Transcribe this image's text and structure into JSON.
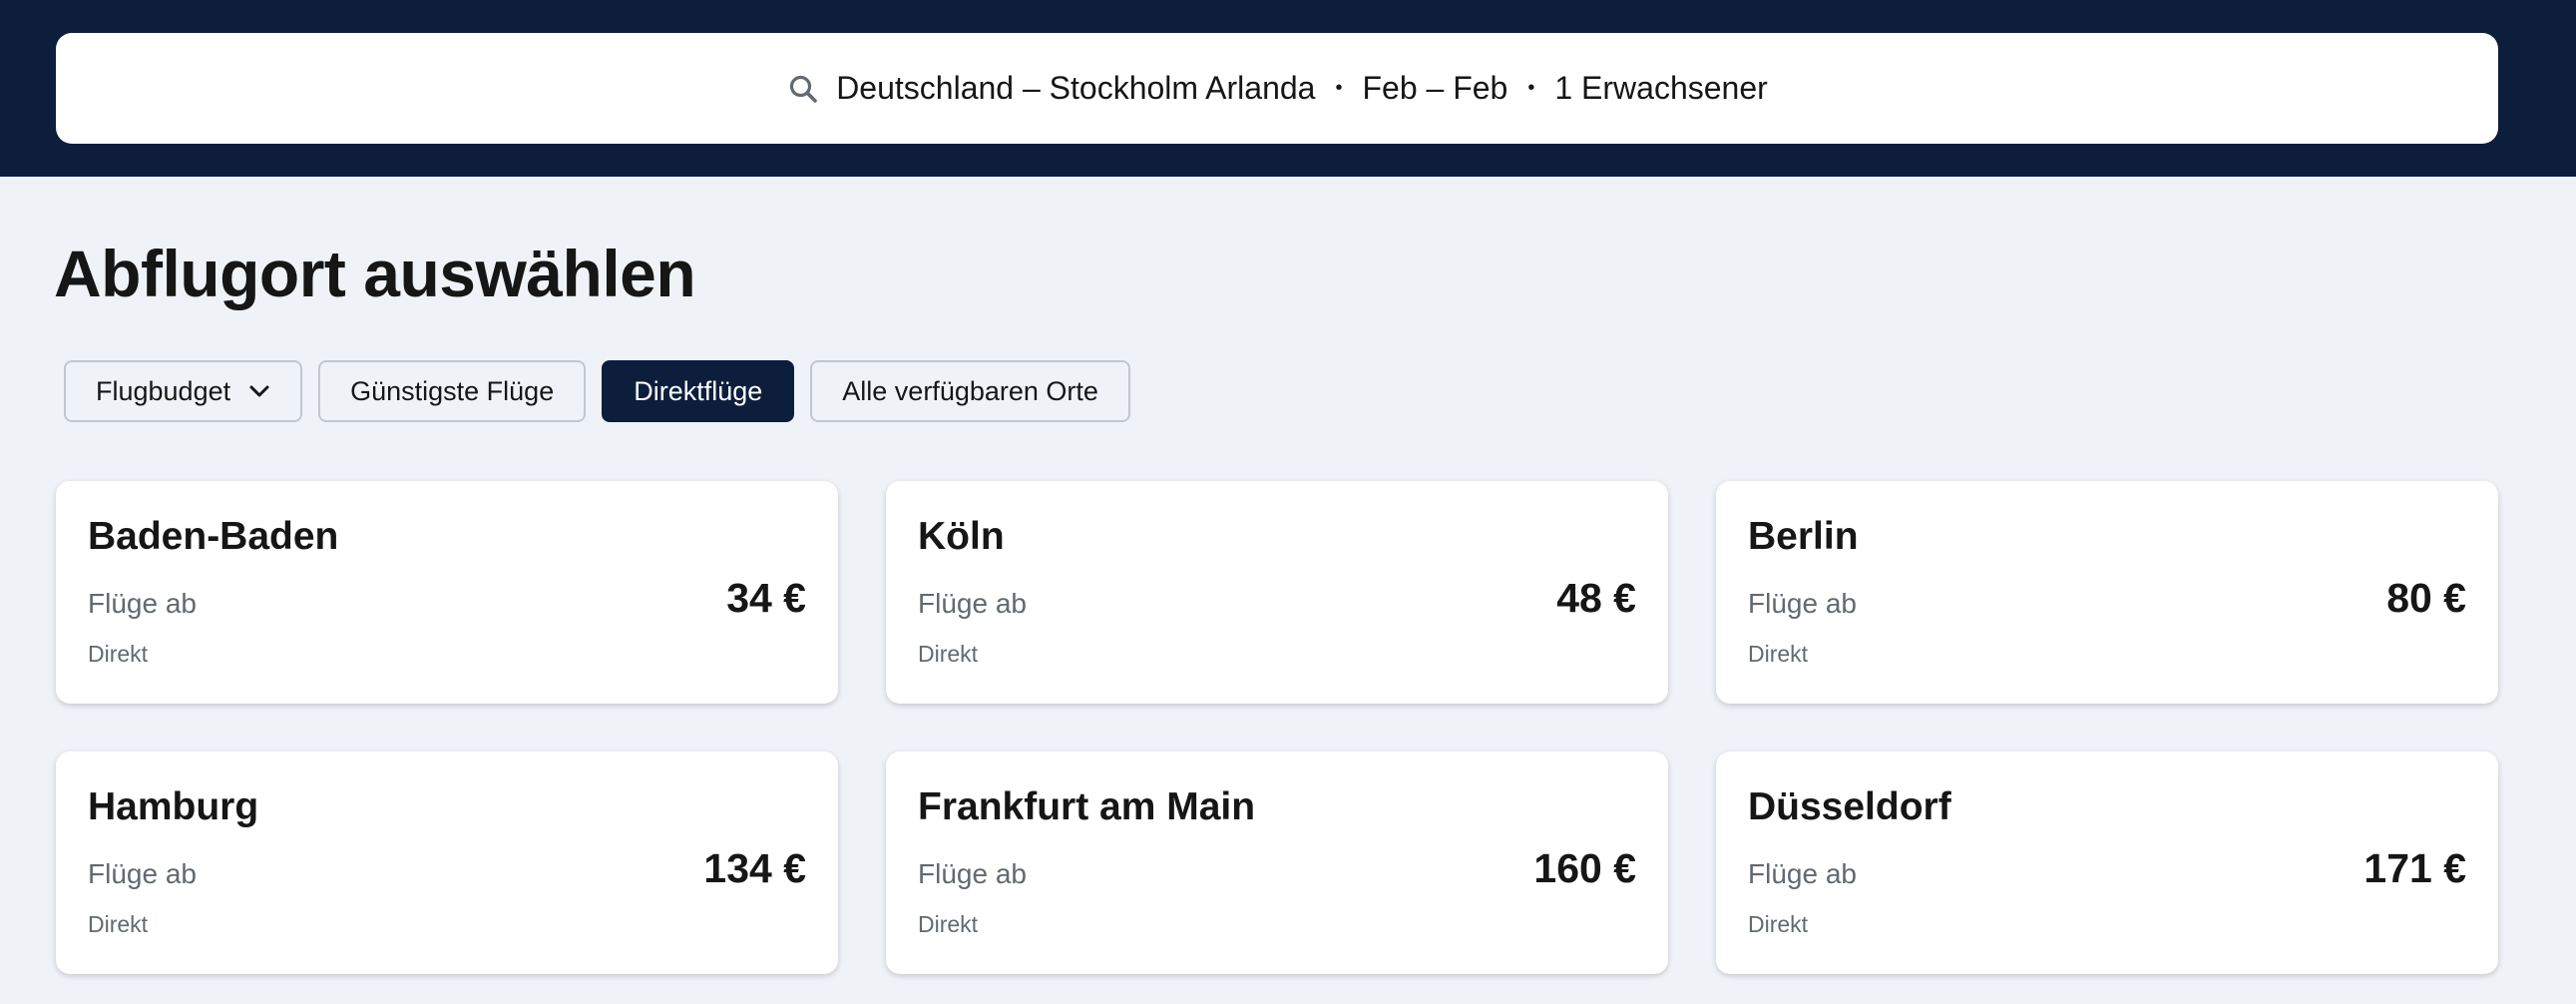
{
  "colors": {
    "header_bg": "#0c1e3c",
    "page_bg": "#eff3f8",
    "active_chip_bg": "#0c1e3c",
    "text_primary": "#161616",
    "text_secondary": "#626971"
  },
  "search_summary": {
    "icon": "search-icon",
    "route": "Deutschland – Stockholm Arlanda",
    "separator": "•",
    "dates": "Feb – Feb",
    "passengers": "1 Erwachsener"
  },
  "page_title": "Abflugort auswählen",
  "filters": [
    {
      "label": "Flugbudget",
      "has_dropdown": true,
      "active": false
    },
    {
      "label": "Günstigste Flüge",
      "active": false
    },
    {
      "label": "Direktflüge",
      "active": true
    },
    {
      "label": "Alle verfügbaren Orte",
      "active": false
    }
  ],
  "destinations": [
    {
      "city": "Baden-Baden",
      "from_label": "Flüge ab",
      "price": "34 €",
      "stops": "Direkt"
    },
    {
      "city": "Köln",
      "from_label": "Flüge ab",
      "price": "48 €",
      "stops": "Direkt"
    },
    {
      "city": "Berlin",
      "from_label": "Flüge ab",
      "price": "80 €",
      "stops": "Direkt"
    },
    {
      "city": "Hamburg",
      "from_label": "Flüge ab",
      "price": "134 €",
      "stops": "Direkt"
    },
    {
      "city": "Frankfurt am Main",
      "from_label": "Flüge ab",
      "price": "160 €",
      "stops": "Direkt"
    },
    {
      "city": "Düsseldorf",
      "from_label": "Flüge ab",
      "price": "171 €",
      "stops": "Direkt"
    }
  ]
}
